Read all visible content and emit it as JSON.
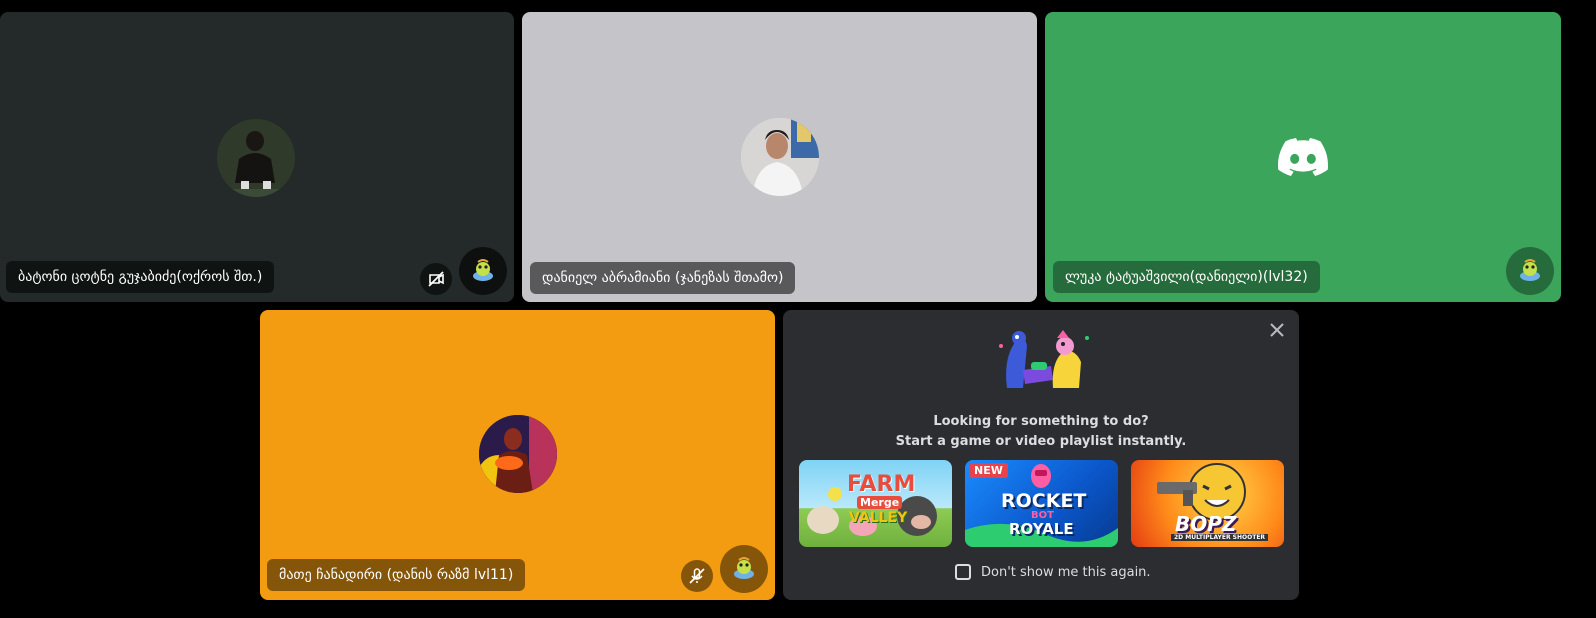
{
  "participants": [
    {
      "name": "ბატონი ცოტნე გუჯაბიძე(ოქროს შთ.)",
      "tile_color": "#232a29",
      "avatar": "photo of person sitting on dark background",
      "muted": false,
      "video_off": true,
      "activity": "game-activity-icon"
    },
    {
      "name": "დანიელ აბრამიანი (ჯანეზას შთამო)",
      "tile_color": "#c5c4c9",
      "avatar": "photo of person in white shirt",
      "muted": false,
      "video_off": false,
      "activity": null
    },
    {
      "name": "ლუკა ტატუაშვილი(დანიელი)(lvl32)",
      "tile_color": "#3ba55c",
      "avatar": "discord-logo",
      "muted": false,
      "video_off": false,
      "activity": "game-activity-icon"
    },
    {
      "name": "მათე ჩანადირი (დანის რაზმ lvl11)",
      "tile_color": "#f39c12",
      "avatar": "red-orange game character",
      "muted": true,
      "video_off": false,
      "activity": "game-activity-icon"
    }
  ],
  "activity_promo": {
    "title_line1": "Looking for something to do?",
    "title_line2": "Start a game or video playlist instantly.",
    "games": [
      {
        "name": "Farm Merge Valley",
        "label_main": "FARM",
        "label_sub": "Merge",
        "label_end": "VALLEY",
        "new": false
      },
      {
        "name": "Rocket Bot Royale",
        "label_main": "ROCKET",
        "label_sub": "BOT",
        "label_end": "ROYALE",
        "new": true,
        "badge": "NEW"
      },
      {
        "name": "Bopz.io",
        "label_main": "BOPZ",
        "label_sub": "2D MULTIPLAYER SHOOTER",
        "label_end": "",
        "new": false
      }
    ],
    "dont_show_label": "Don't show me this again.",
    "close_icon": "close-icon"
  },
  "colors": {
    "background": "#000000",
    "promo_bg": "#2b2d31",
    "discord_green": "#3ba55c"
  }
}
